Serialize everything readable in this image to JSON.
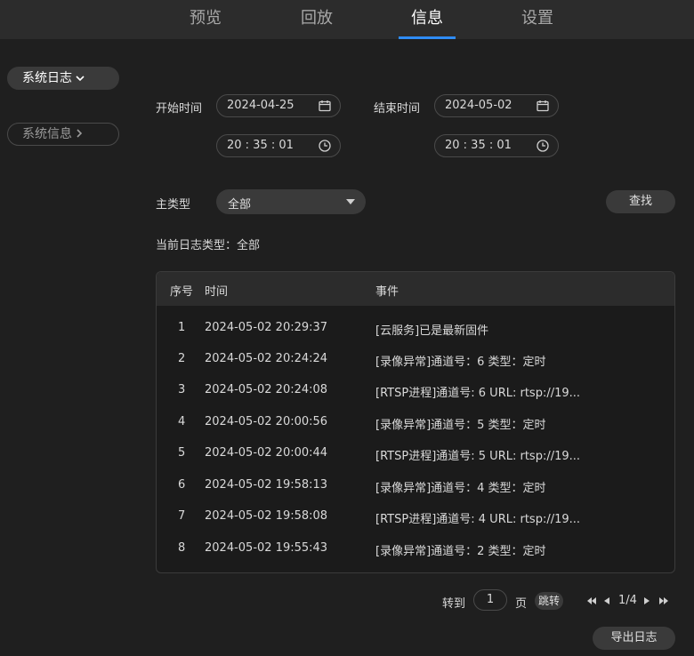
{
  "tabs": [
    {
      "label": "预览"
    },
    {
      "label": "回放"
    },
    {
      "label": "信息"
    },
    {
      "label": "设置"
    }
  ],
  "active_tab": "信息",
  "sidebar": {
    "items": [
      {
        "label": "系统日志"
      },
      {
        "label": "系统信息"
      }
    ]
  },
  "filters": {
    "start_label": "开始时间",
    "start_date": "2024-04-25",
    "start_time": "20 : 35 : 01",
    "end_label": "结束时间",
    "end_date": "2024-05-02",
    "end_time": "20 : 35 : 01",
    "type_label": "主类型",
    "type_value": "全部",
    "search_label": "查找",
    "current_type": "当前日志类型：全部"
  },
  "table": {
    "headers": [
      "序号",
      "时间",
      "事件"
    ],
    "rows": [
      {
        "no": "1",
        "time": "2024-05-02 20:29:37",
        "event": "[云服务]已是最新固件"
      },
      {
        "no": "2",
        "time": "2024-05-02 20:24:24",
        "event": "[录像异常]通道号：6 类型：定时"
      },
      {
        "no": "3",
        "time": "2024-05-02 20:24:08",
        "event": "[RTSP进程]通道号: 6 URL: rtsp://19..."
      },
      {
        "no": "4",
        "time": "2024-05-02 20:00:56",
        "event": "[录像异常]通道号：5 类型：定时"
      },
      {
        "no": "5",
        "time": "2024-05-02 20:00:44",
        "event": "[RTSP进程]通道号: 5 URL: rtsp://19..."
      },
      {
        "no": "6",
        "time": "2024-05-02 19:58:13",
        "event": "[录像异常]通道号：4 类型：定时"
      },
      {
        "no": "7",
        "time": "2024-05-02 19:58:08",
        "event": "[RTSP进程]通道号: 4 URL: rtsp://19..."
      },
      {
        "no": "8",
        "time": "2024-05-02 19:55:43",
        "event": "[录像异常]通道号：2 类型：定时"
      }
    ]
  },
  "pager": {
    "goto_label": "转到",
    "page_input": "1",
    "page_unit": "页",
    "jump_label": "跳转",
    "page_status": "1/4"
  },
  "export_label": "导出日志",
  "colors": {
    "accent": "#2f8cf5",
    "background": "#1f1f1f",
    "topbar": "#2c2c2c"
  }
}
